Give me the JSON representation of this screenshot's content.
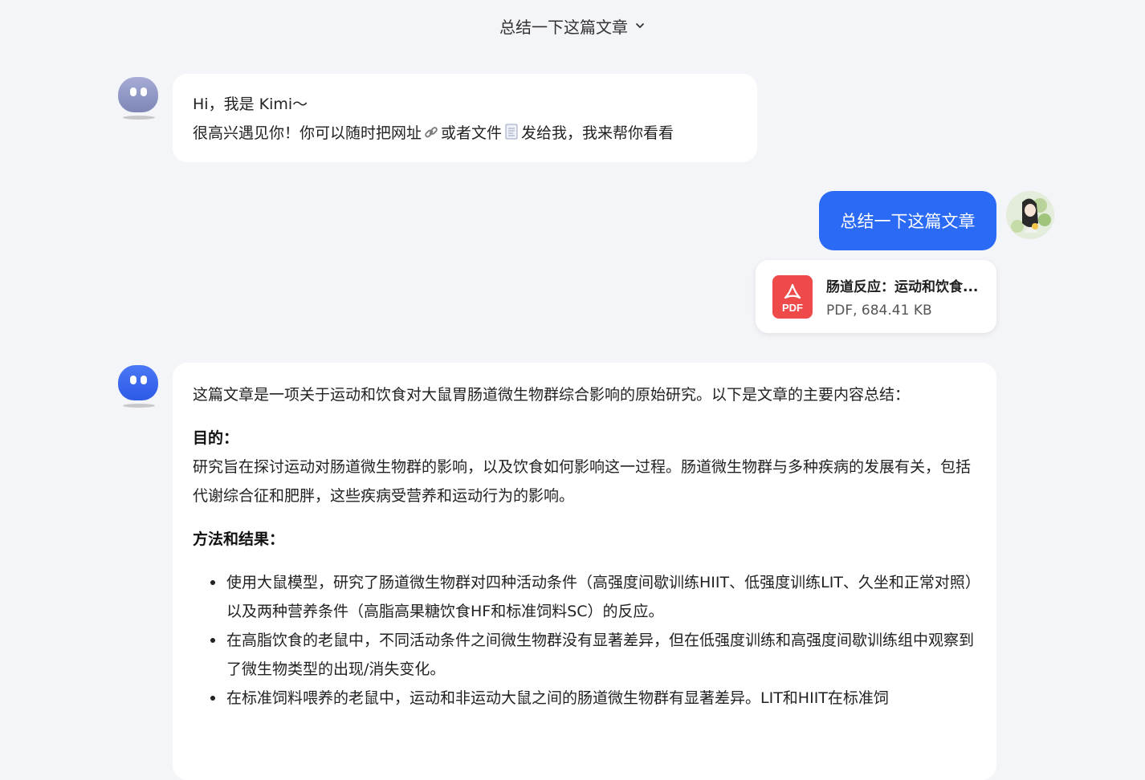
{
  "header": {
    "title": "总结一下这篇文章"
  },
  "greeting": {
    "line1": "Hi，我是 Kimi～",
    "line2_a": "很高兴遇见你！你可以随时把网址",
    "line2_b": "或者文件",
    "line2_c": "发给我，我来帮你看看",
    "icons": [
      "link-emoji",
      "document-emoji"
    ]
  },
  "user_message": {
    "text": "总结一下这篇文章"
  },
  "attachment": {
    "name": "肠道反应：运动和饮食...",
    "meta": "PDF, 684.41 KB",
    "icon_label": "PDF"
  },
  "answer": {
    "intro": "这篇文章是一项关于运动和饮食对大鼠胃肠道微生物群综合影响的原始研究。以下是文章的主要内容总结：",
    "purpose_heading": "目的：",
    "purpose_text": "研究旨在探讨运动对肠道微生物群的影响，以及饮食如何影响这一过程。肠道微生物群与多种疾病的发展有关，包括代谢综合征和肥胖，这些疾病受营养和运动行为的影响。",
    "methods_heading": "方法和结果：",
    "bullets": [
      "使用大鼠模型，研究了肠道微生物群对四种活动条件（高强度间歇训练HIIT、低强度训练LIT、久坐和正常对照）以及两种营养条件（高脂高果糖饮食HF和标准饲料SC）的反应。",
      "在高脂饮食的老鼠中，不同活动条件之间微生物群没有显著差异，但在低强度训练和高强度间歇训练组中观察到了微生物类型的出现/消失变化。",
      "在标准饲料喂养的老鼠中，运动和非运动大鼠之间的肠道微生物群有显著差异。LIT和HIIT在标准饲"
    ]
  },
  "colors": {
    "background": "#f4f5f9",
    "user_bubble": "#2b6af5",
    "bot_face_faded": "#8b94c4",
    "bot_face_active": "#3a66f0",
    "pdf_red": "#ee4a4a"
  }
}
